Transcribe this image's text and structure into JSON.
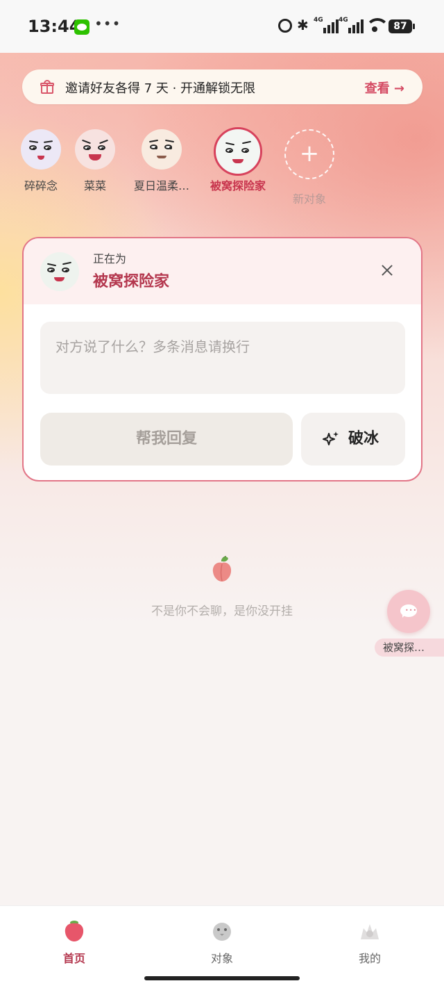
{
  "status_bar": {
    "time": "13:44",
    "icons": [
      "wechat-icon",
      "more-dots-icon",
      "alarm-icon",
      "bluetooth-icon",
      "signal-4g-icon",
      "signal-4g-icon",
      "wifi-icon"
    ],
    "network_1": "4G",
    "network_2": "4G",
    "battery": "87"
  },
  "invite_banner": {
    "icon": "gift-icon",
    "text": "邀请好友各得 7 天 · 开通解锁无限",
    "link": "查看 →"
  },
  "contacts": [
    {
      "name": "碎碎念",
      "active": false
    },
    {
      "name": "菜菜",
      "active": false
    },
    {
      "name": "夏日温柔…",
      "active": false
    },
    {
      "name": "被窝探险家",
      "active": true
    }
  ],
  "new_contact_label": "新对象",
  "new_contact_icon": "+",
  "card": {
    "label": "正在为",
    "name": "被窝探险家",
    "input_placeholder": "对方说了什么？多条消息请换行",
    "input_value": "",
    "reply_button": "帮我回复",
    "icebreak_button": "破冰"
  },
  "slogan": "不是你不会聊，是你没开挂",
  "floating": {
    "label": "被窝探…"
  },
  "tabs": [
    {
      "label": "首页",
      "icon": "peach-icon",
      "active": true
    },
    {
      "label": "对象",
      "icon": "chick-icon",
      "active": false
    },
    {
      "label": "我的",
      "icon": "profile-icon",
      "active": false
    }
  ],
  "colors": {
    "accent": "#d44962",
    "active_name": "#c8354e",
    "card_border": "#e27587"
  }
}
